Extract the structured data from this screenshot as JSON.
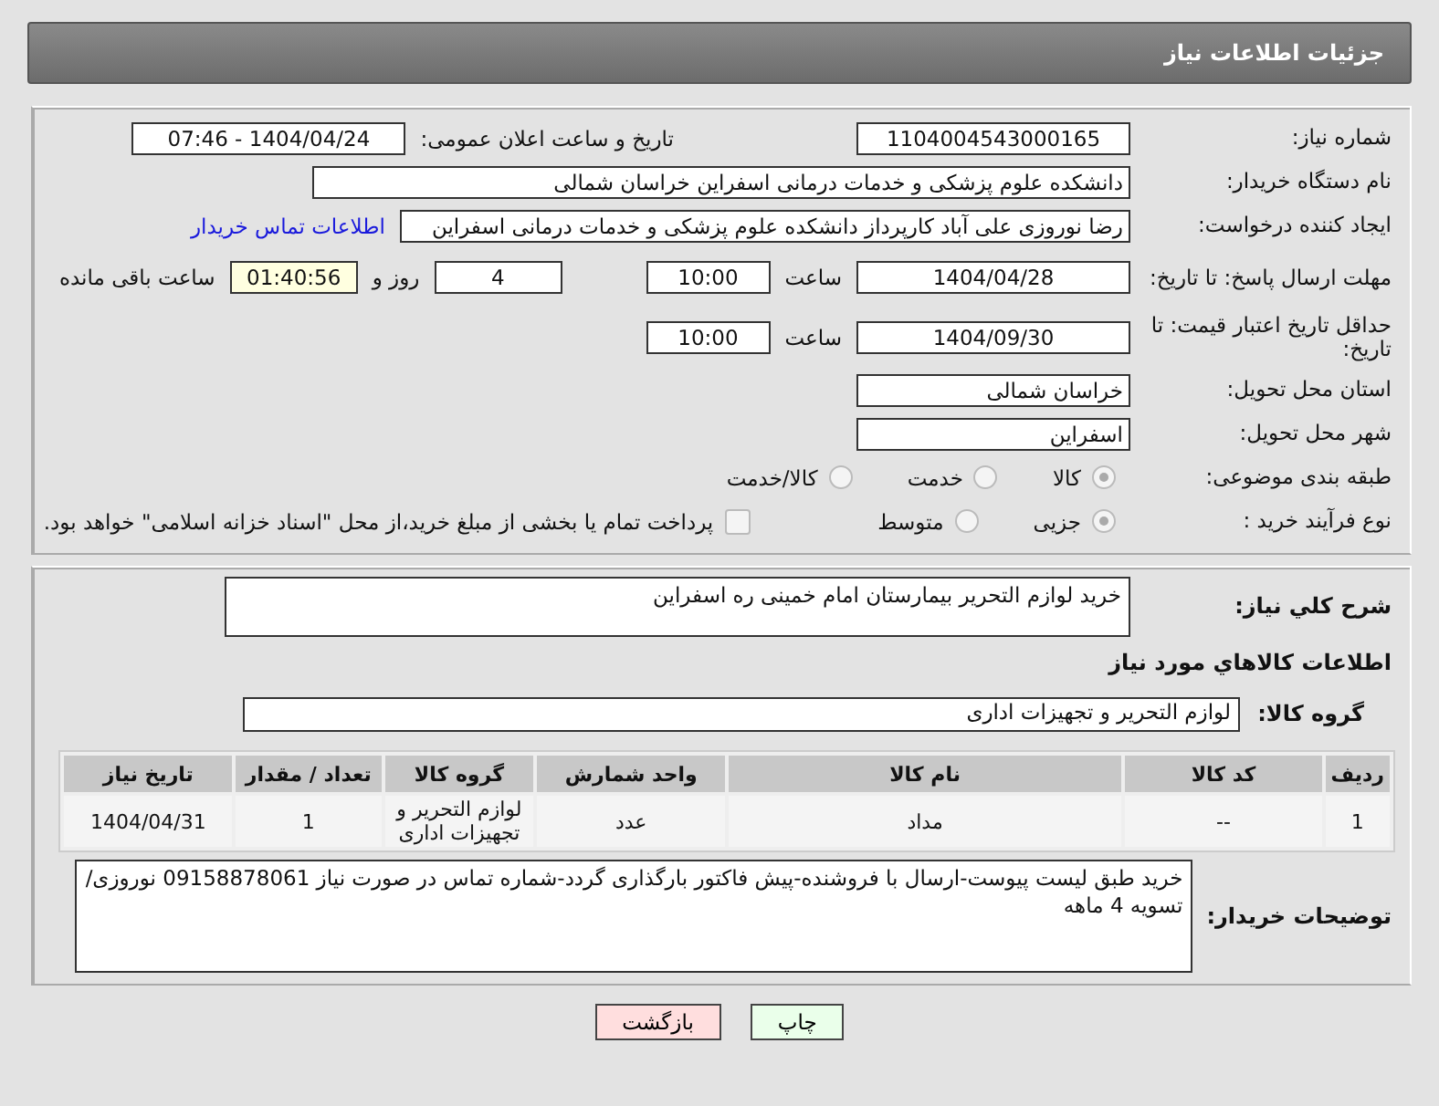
{
  "header": {
    "title": "جزئیات اطلاعات نیاز"
  },
  "need_number": {
    "label": "شماره نیاز:",
    "value": "1104004543000165"
  },
  "announce": {
    "label": "تاریخ و ساعت اعلان عمومی:",
    "value": "1404/04/24 - 07:46"
  },
  "buyer_org": {
    "label": "نام دستگاه خریدار:",
    "value": "دانشکده علوم پزشکی و خدمات درمانی اسفراین خراسان شمالی"
  },
  "requester": {
    "label": "ایجاد کننده درخواست:",
    "value": "رضا نوروزی علی آباد کارپرداز  دانشکده علوم پزشکی و خدمات درمانی اسفراین",
    "link": "اطلاعات تماس خریدار"
  },
  "deadline": {
    "label": "مهلت ارسال پاسخ: تا تاریخ:",
    "date": "1404/04/28",
    "time_label": "ساعت",
    "time": "10:00",
    "days": "4",
    "days_label": "روز و",
    "remaining": "01:40:56",
    "remaining_label": "ساعت باقی مانده"
  },
  "validity": {
    "label": "حداقل تاریخ اعتبار قیمت: تا تاریخ:",
    "date": "1404/09/30",
    "time_label": "ساعت",
    "time": "10:00"
  },
  "province": {
    "label": "استان محل تحویل:",
    "value": "خراسان شمالی"
  },
  "city": {
    "label": "شهر محل تحویل:",
    "value": "اسفراین"
  },
  "category": {
    "label": "طبقه بندی موضوعی:",
    "options": [
      {
        "label": "کالا",
        "selected": true
      },
      {
        "label": "خدمت",
        "selected": false
      },
      {
        "label": "کالا/خدمت",
        "selected": false
      }
    ]
  },
  "process": {
    "label": "نوع فرآیند خرید :",
    "options": [
      {
        "label": "جزیی",
        "selected": true
      },
      {
        "label": "متوسط",
        "selected": false
      }
    ],
    "treasury": {
      "label": "پرداخت تمام یا بخشی از مبلغ خرید،از محل \"اسناد خزانه اسلامی\" خواهد بود.",
      "checked": false
    }
  },
  "summary": {
    "label": "شرح کلي نياز:",
    "value": "خرید لوازم التحریر بیمارستان امام خمینی ره اسفراین"
  },
  "goods_title": "اطلاعات کالاهاي مورد نياز",
  "goods_group": {
    "label": "گروه کالا:",
    "value": "لوازم التحریر و تجهیزات اداری"
  },
  "table": {
    "columns": [
      "ردیف",
      "کد کالا",
      "نام کالا",
      "واحد شمارش",
      "گروه کالا",
      "تعداد / مقدار",
      "تاریخ نیاز"
    ],
    "rows": [
      [
        "1",
        "--",
        "مداد",
        "عدد",
        "لوازم التحریر و تجهیزات اداری",
        "1",
        "1404/04/31"
      ]
    ]
  },
  "buyer_notes": {
    "label": "توضیحات خریدار:",
    "value": "خرید طبق لیست پیوست-ارسال با فروشنده-پیش فاکتور بارگذاری گردد-شماره تماس در صورت نیاز 09158878061 نوروزی/تسویه 4 ماهه"
  },
  "buttons": [
    {
      "label": "چاپ",
      "kind": "print"
    },
    {
      "label": "بازگشت",
      "kind": "back"
    }
  ]
}
